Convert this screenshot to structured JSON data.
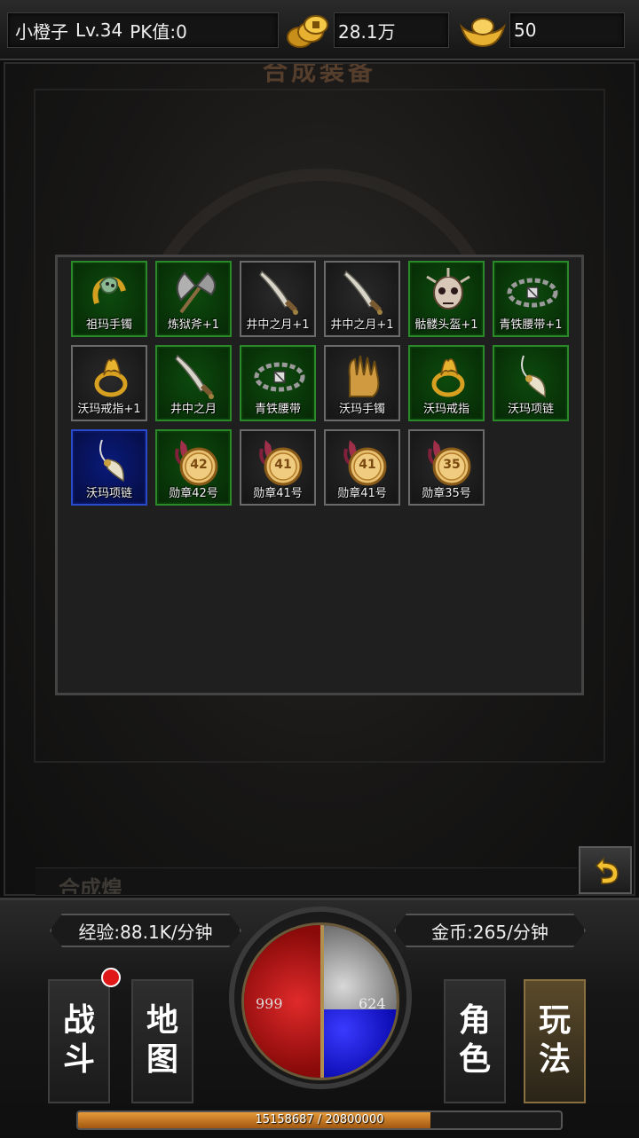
{
  "top_bar": {
    "player_name": "小橙子",
    "level": "Lv.34",
    "pk": "PK值:0",
    "gold": "28.1万",
    "ingot": "50"
  },
  "panel": {
    "title": "合成装备",
    "bottom_text": "合成煌"
  },
  "inventory": {
    "items": [
      {
        "label": "祖玛手镯",
        "rarity": "green",
        "icon": "bracelet-icon"
      },
      {
        "label": "炼狱斧+1",
        "rarity": "green",
        "icon": "axe-icon"
      },
      {
        "label": "井中之月+1",
        "rarity": "gray",
        "icon": "sword-icon"
      },
      {
        "label": "井中之月+1",
        "rarity": "gray",
        "icon": "sword-icon"
      },
      {
        "label": "骷髅头盔+1",
        "rarity": "green",
        "icon": "skull-helmet-icon"
      },
      {
        "label": "青铁腰带+1",
        "rarity": "green",
        "icon": "belt-icon"
      },
      {
        "label": "沃玛戒指+1",
        "rarity": "gray",
        "icon": "ring-icon"
      },
      {
        "label": "井中之月",
        "rarity": "green",
        "icon": "sword-icon"
      },
      {
        "label": "青铁腰带",
        "rarity": "green",
        "icon": "belt-icon"
      },
      {
        "label": "沃玛手镯",
        "rarity": "gray",
        "icon": "gauntlet-icon"
      },
      {
        "label": "沃玛戒指",
        "rarity": "green",
        "icon": "ring-icon"
      },
      {
        "label": "沃玛项链",
        "rarity": "green",
        "icon": "necklace-icon"
      },
      {
        "label": "沃玛项链",
        "rarity": "blue",
        "icon": "necklace-icon"
      },
      {
        "label": "勋章42号",
        "rarity": "green",
        "icon": "medal-icon",
        "medal": "42"
      },
      {
        "label": "勋章41号",
        "rarity": "gray",
        "icon": "medal-icon",
        "medal": "41"
      },
      {
        "label": "勋章41号",
        "rarity": "gray",
        "icon": "medal-icon",
        "medal": "41"
      },
      {
        "label": "勋章35号",
        "rarity": "gray",
        "icon": "medal-icon",
        "medal": "35"
      }
    ]
  },
  "hud": {
    "exp_rate": "经验:88.1K/分钟",
    "gold_rate": "金币:265/分钟",
    "hp": "999",
    "mp": "624",
    "mp_fill_fraction": 0.45,
    "exp_text": "15158687 / 20800000",
    "exp_fraction": 0.729,
    "buttons": {
      "battle": "战斗",
      "map": "地图",
      "role": "角色",
      "play": "玩法"
    }
  },
  "colors": {
    "green_slot": "#2a8a2a",
    "gray_slot": "#6a6a6a",
    "blue_slot": "#2a4acc",
    "hp": "#e02a2a",
    "mp": "#2a2aee",
    "exp_bar": "#d88a2a"
  }
}
